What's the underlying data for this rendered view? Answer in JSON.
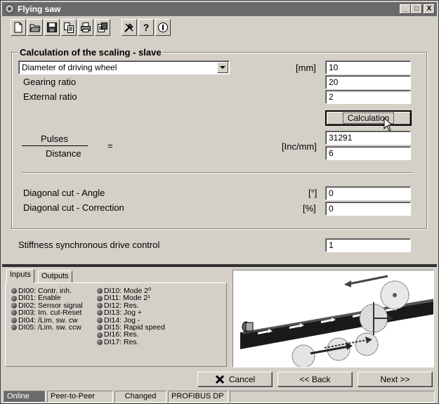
{
  "window": {
    "title": "Flying saw",
    "controls": {
      "minimize": "_",
      "maximize": "□",
      "close": "X"
    }
  },
  "toolbar": {
    "icons": [
      "new-file-icon",
      "open-folder-icon",
      "save-icon",
      "copy-icon",
      "print-icon",
      "export-icon",
      "tools-icon",
      "help-icon",
      "info-icon"
    ]
  },
  "group": {
    "title": "Calculation of the scaling - slave",
    "combo_value": "Diameter of driving wheel",
    "diameter_unit": "[mm]",
    "diameter_value": "10",
    "gearing_label": "Gearing ratio",
    "gearing_value": "20",
    "external_label": "External ratio",
    "external_value": "2",
    "calc_button": "Calculation",
    "pulses_label": "Pulses",
    "distance_label": "Distance",
    "equals": "=",
    "fraction_unit": "[Inc/mm]",
    "pulses_value": "31291",
    "distance_value": "6",
    "angle_label": "Diagonal cut - Angle",
    "angle_unit": "[°]",
    "angle_value": "0",
    "correction_label": "Diagonal cut - Correction",
    "correction_unit": "[%]",
    "correction_value": "0"
  },
  "stiffness": {
    "label": "Stiffness synchronous drive control",
    "value": "1"
  },
  "tabs": [
    {
      "label": "Inputs",
      "active": true
    },
    {
      "label": "Outputs",
      "active": false
    }
  ],
  "inputs_left": [
    "DI00: Contr. inh.",
    "DI01: Enable",
    "DI02: Sensor signal",
    "DI03: Im. cut-Reset",
    "DI04: /Lim. sw. cw",
    "DI05: /Lim. sw. ccw"
  ],
  "inputs_right": [
    "DI10: Mode 2⁰",
    "DI11: Mode 2¹",
    "DI12: Res.",
    "DI13: Jog +",
    "DI14: Jog -",
    "DI15: Rapid speed",
    "DI16: Res.",
    "DI17: Res."
  ],
  "nav": {
    "cancel": "Cancel",
    "back": "<< Back",
    "next": "Next >>"
  },
  "status": {
    "online": "Online",
    "mode": "Peer-to-Peer",
    "changed": "Changed",
    "bus": "PROFIBUS DP"
  }
}
